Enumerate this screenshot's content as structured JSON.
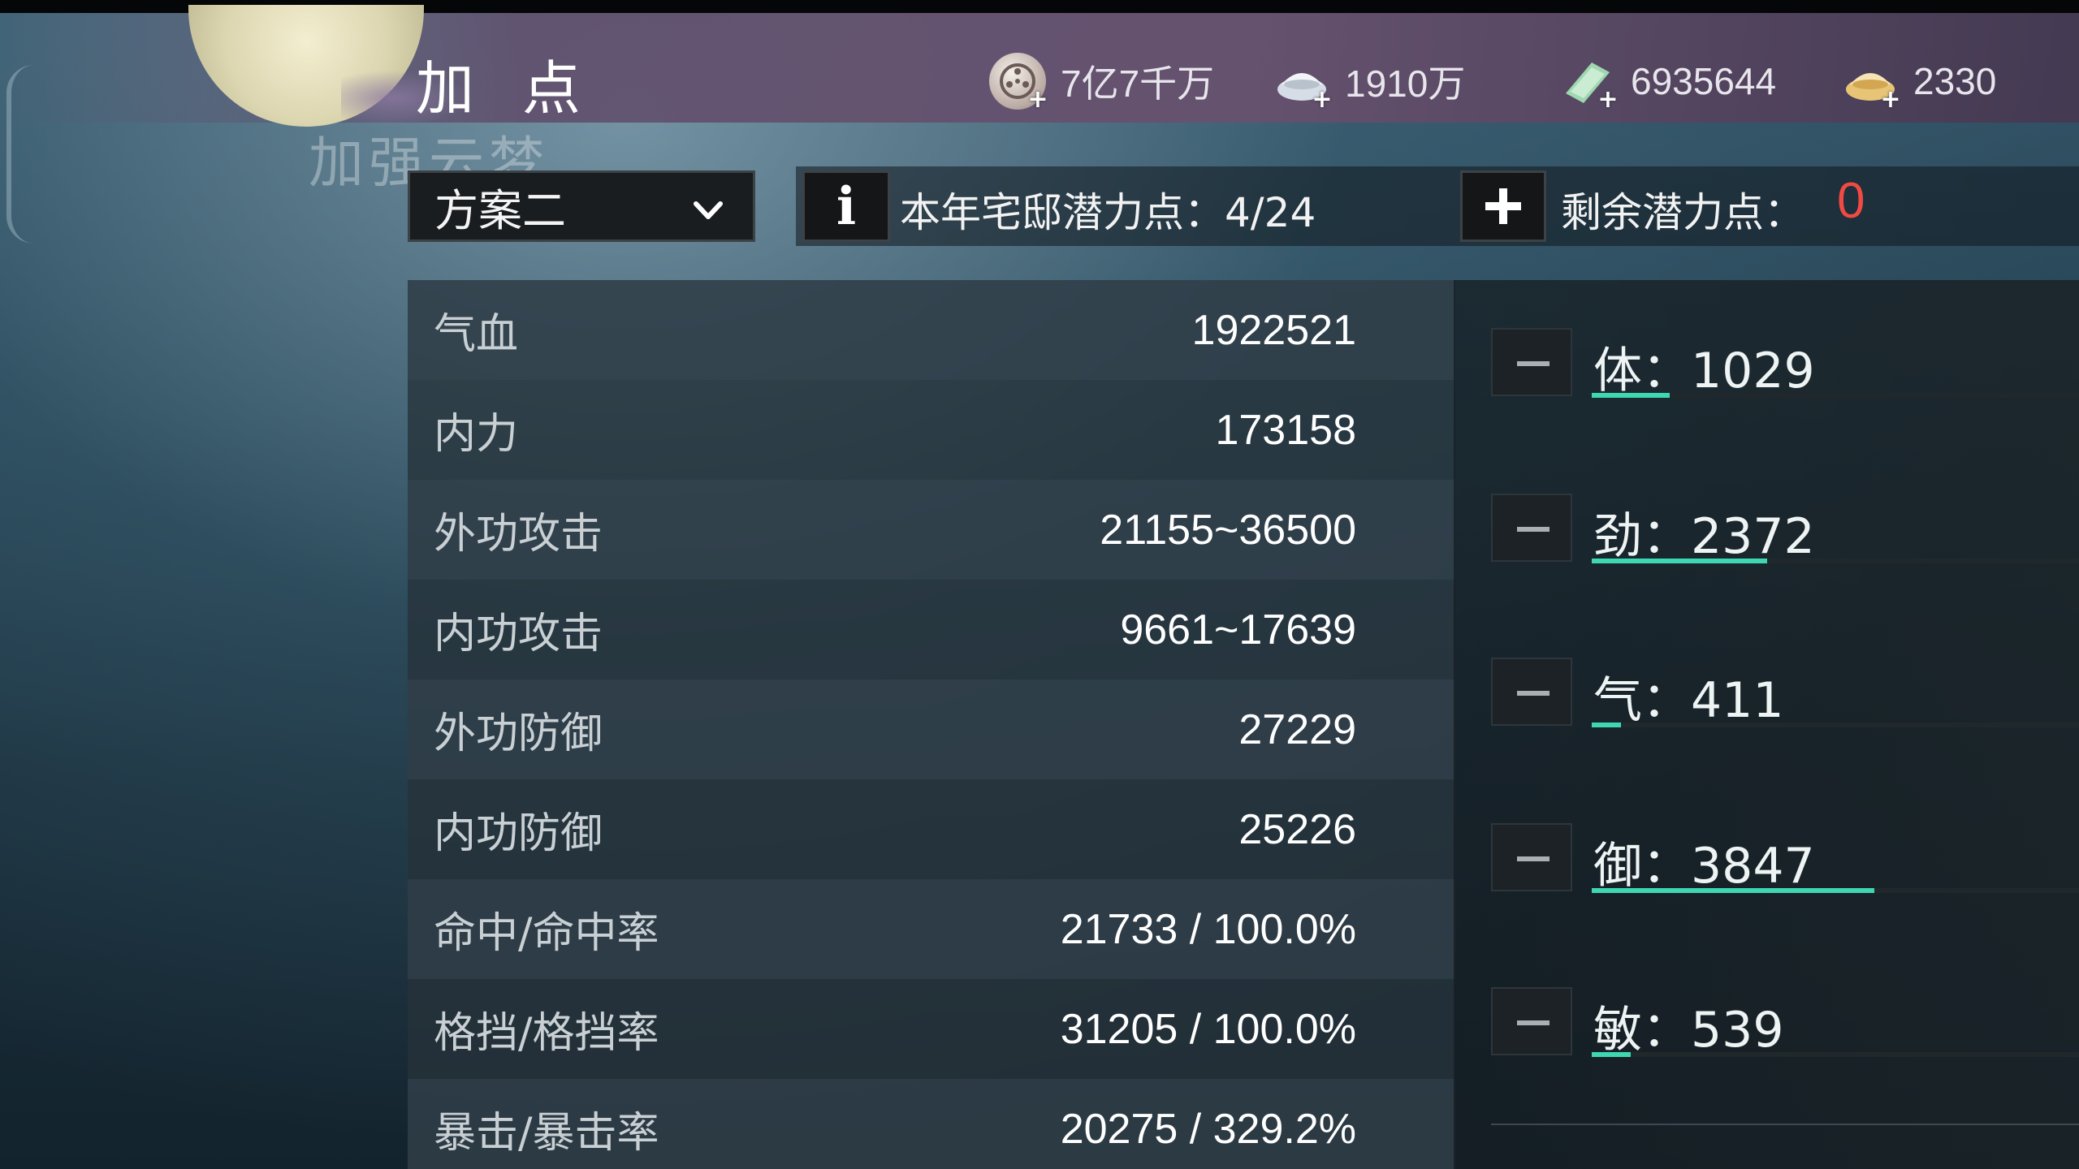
{
  "header": {
    "title": "加 点",
    "subtitle": "加强云梦",
    "currencies": [
      {
        "icon": "coin-icon",
        "value": "7亿7千万"
      },
      {
        "icon": "silver-ingot-icon",
        "value": "1910万"
      },
      {
        "icon": "jade-icon",
        "value": "6935644"
      },
      {
        "icon": "gold-ingot-icon",
        "value": "2330"
      }
    ]
  },
  "controls": {
    "plan_selected": "方案二",
    "yearly_potential": "本年宅邸潜力点：4/24",
    "remaining_label": "剩余潜力点：",
    "remaining_value": "0"
  },
  "stats": [
    {
      "name": "气血",
      "value": "1922521"
    },
    {
      "name": "内力",
      "value": "173158"
    },
    {
      "name": "外功攻击",
      "value": "21155~36500"
    },
    {
      "name": "内功攻击",
      "value": "9661~17639"
    },
    {
      "name": "外功防御",
      "value": "27229"
    },
    {
      "name": "内功防御",
      "value": "25226"
    },
    {
      "name": "命中/命中率",
      "value": "21733 / 100.0%"
    },
    {
      "name": "格挡/格挡率",
      "value": "31205 / 100.0%"
    },
    {
      "name": "暴击/暴击率",
      "value": "20275 / 329.2%"
    }
  ],
  "attributes": [
    {
      "label": "体：1029",
      "fill_fraction": 0.16
    },
    {
      "label": "劲：2372",
      "fill_fraction": 0.36
    },
    {
      "label": "气：411",
      "fill_fraction": 0.06
    },
    {
      "label": "御：3847",
      "fill_fraction": 0.58
    },
    {
      "label": "敏：539",
      "fill_fraction": 0.08
    }
  ],
  "colors": {
    "accent_fill": "#3fd7b2",
    "remaining_red": "#f04a43"
  }
}
